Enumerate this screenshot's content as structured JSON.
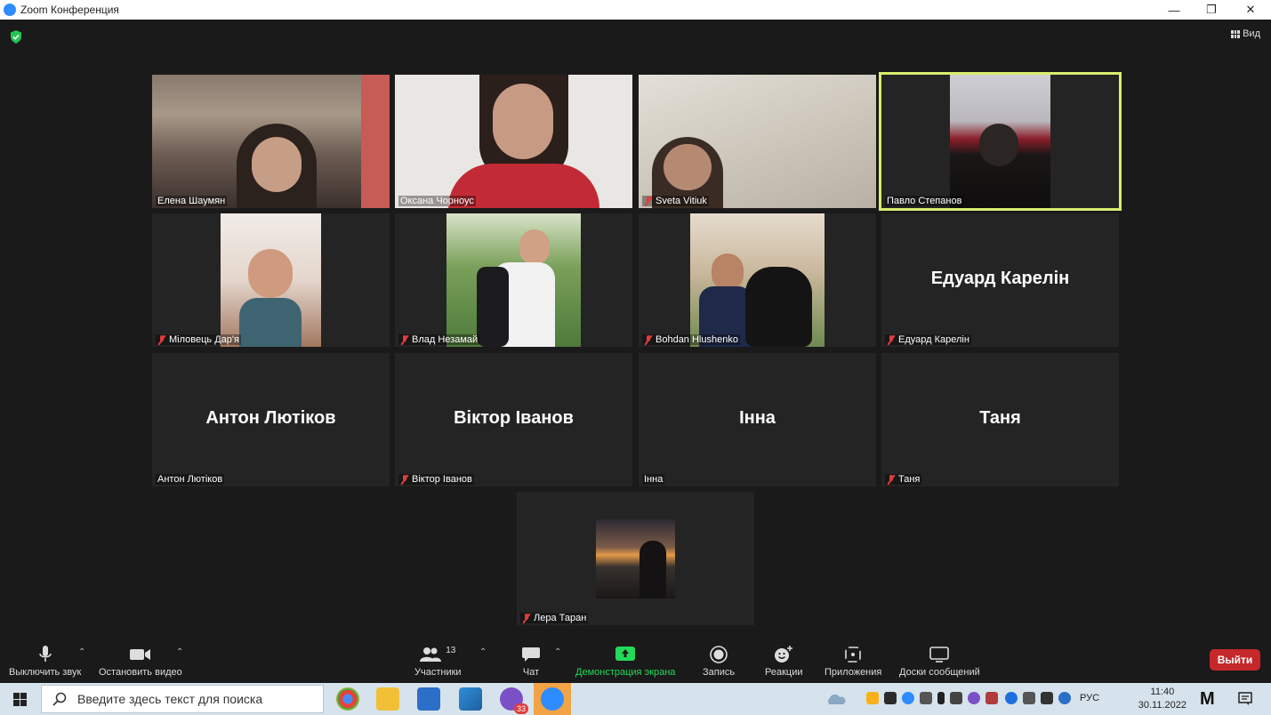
{
  "window": {
    "title": "Zoom Конференция"
  },
  "header": {
    "view_label": "Вид"
  },
  "participants": [
    {
      "name": "Елена Шаумян",
      "muted": false,
      "video": true
    },
    {
      "name": "Оксана Чорноус",
      "muted": false,
      "video": true
    },
    {
      "name": "Sveta Vitiuk",
      "muted": true,
      "video": true
    },
    {
      "name": "Павло Степанов",
      "muted": false,
      "video": true,
      "active_speaker": true
    },
    {
      "name": "Міловець Дар'я",
      "muted": true,
      "video": true
    },
    {
      "name": "Влад Незамай",
      "muted": true,
      "video": true
    },
    {
      "name": "Bohdan Hlushenko",
      "muted": true,
      "video": true
    },
    {
      "name": "Едуард Карелін",
      "muted": true,
      "video": false,
      "display_name": "Едуард Карелін"
    },
    {
      "name": "Антон Лютіков",
      "muted": false,
      "video": false,
      "display_name": "Антон Лютіков"
    },
    {
      "name": "Віктор Іванов",
      "muted": true,
      "video": false,
      "display_name": "Віктор Іванов"
    },
    {
      "name": "Інна",
      "muted": false,
      "video": false,
      "display_name": "Інна"
    },
    {
      "name": "Таня",
      "muted": true,
      "video": false,
      "display_name": "Таня"
    },
    {
      "name": "Лера Таран",
      "muted": true,
      "video": true
    }
  ],
  "toolbar": {
    "mute_label": "Выключить звук",
    "video_label": "Остановить видео",
    "participants_label": "Участники",
    "participants_count": "13",
    "chat_label": "Чат",
    "share_label": "Демонстрация экрана",
    "record_label": "Запись",
    "reactions_label": "Реакции",
    "apps_label": "Приложения",
    "whiteboard_label": "Доски сообщений",
    "leave_label": "Выйти"
  },
  "taskbar": {
    "search_placeholder": "Введите здесь текст для поиска",
    "viber_badge": "33",
    "language": "РУС",
    "time": "11:40",
    "date": "30.11.2022"
  },
  "colors": {
    "active_speaker_border": "#d7ee6e",
    "share_green": "#23d959",
    "leave_red": "#c4282b",
    "mute_red": "#e03c3c"
  }
}
